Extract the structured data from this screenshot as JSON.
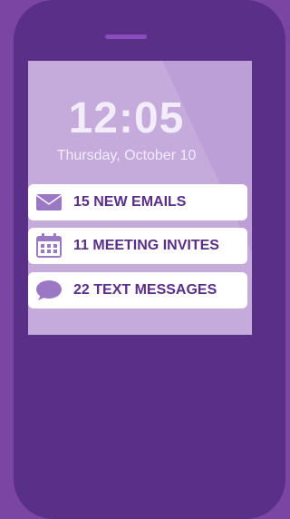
{
  "lock_screen": {
    "time": "12:05",
    "date": "Thursday, October 10"
  },
  "notifications": [
    {
      "icon": "envelope-icon",
      "label": "15 NEW EMAILS"
    },
    {
      "icon": "calendar-icon",
      "label": "11 MEETING INVITES"
    },
    {
      "icon": "chat-bubble-icon",
      "label": "22 TEXT MESSAGES"
    }
  ],
  "colors": {
    "background": "#7b45a4",
    "phone_body": "#5a2f87",
    "screen": "#bd9fd8",
    "notification_card": "#ffffff",
    "notification_text": "#5a2f87",
    "icon_fill": "#9b78c4"
  }
}
